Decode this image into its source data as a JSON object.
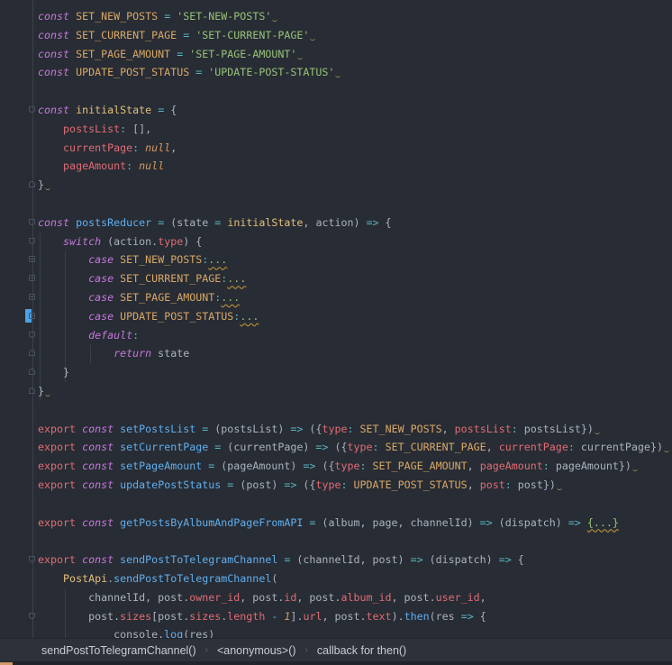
{
  "code": {
    "lines": [
      {
        "tokens": [
          [
            "k",
            "const"
          ],
          [
            "t",
            " "
          ],
          [
            "cn",
            "SET_NEW_POSTS"
          ],
          [
            "t",
            " "
          ],
          [
            "o",
            "="
          ],
          [
            "t",
            " "
          ],
          [
            "s",
            "'SET-NEW-POSTS'"
          ]
        ],
        "warn": true
      },
      {
        "tokens": [
          [
            "k",
            "const"
          ],
          [
            "t",
            " "
          ],
          [
            "cn",
            "SET_CURRENT_PAGE"
          ],
          [
            "t",
            " "
          ],
          [
            "o",
            "="
          ],
          [
            "t",
            " "
          ],
          [
            "s",
            "'SET-CURRENT-PAGE'"
          ]
        ],
        "warn": true
      },
      {
        "tokens": [
          [
            "k",
            "const"
          ],
          [
            "t",
            " "
          ],
          [
            "cn",
            "SET_PAGE_AMOUNT"
          ],
          [
            "t",
            " "
          ],
          [
            "o",
            "="
          ],
          [
            "t",
            " "
          ],
          [
            "s",
            "'SET-PAGE-AMOUNT'"
          ]
        ],
        "warn": true
      },
      {
        "tokens": [
          [
            "k",
            "const"
          ],
          [
            "t",
            " "
          ],
          [
            "cn",
            "UPDATE_POST_STATUS"
          ],
          [
            "t",
            " "
          ],
          [
            "o",
            "="
          ],
          [
            "t",
            " "
          ],
          [
            "s",
            "'UPDATE-POST-STATUS'"
          ]
        ],
        "warn": true
      },
      {
        "tokens": []
      },
      {
        "tokens": [
          [
            "k",
            "const"
          ],
          [
            "t",
            " "
          ],
          [
            "cl",
            "initialState"
          ],
          [
            "t",
            " "
          ],
          [
            "o",
            "="
          ],
          [
            "t",
            " {"
          ]
        ],
        "fold": "open"
      },
      {
        "tokens": [
          [
            "t",
            "    "
          ],
          [
            "p",
            "postsList"
          ],
          [
            "o",
            ":"
          ],
          [
            "t",
            " [],"
          ]
        ]
      },
      {
        "tokens": [
          [
            "t",
            "    "
          ],
          [
            "p",
            "currentPage"
          ],
          [
            "o",
            ":"
          ],
          [
            "t",
            " "
          ],
          [
            "n",
            "null"
          ],
          [
            "t",
            ","
          ]
        ]
      },
      {
        "tokens": [
          [
            "t",
            "    "
          ],
          [
            "p",
            "pageAmount"
          ],
          [
            "o",
            ":"
          ],
          [
            "t",
            " "
          ],
          [
            "n",
            "null"
          ]
        ]
      },
      {
        "tokens": [
          [
            "t",
            "}"
          ]
        ],
        "warn": true,
        "fold": "close"
      },
      {
        "tokens": []
      },
      {
        "tokens": [
          [
            "k",
            "const"
          ],
          [
            "t",
            " "
          ],
          [
            "f",
            "postsReducer"
          ],
          [
            "t",
            " "
          ],
          [
            "o",
            "="
          ],
          [
            "t",
            " (state "
          ],
          [
            "o",
            "="
          ],
          [
            "t",
            " "
          ],
          [
            "cl",
            "initialState"
          ],
          [
            "t",
            ", action) "
          ],
          [
            "o",
            "=>"
          ],
          [
            "t",
            " {"
          ]
        ],
        "fold": "open"
      },
      {
        "tokens": [
          [
            "t",
            "    "
          ],
          [
            "k",
            "switch"
          ],
          [
            "t",
            " (action."
          ],
          [
            "p",
            "type"
          ],
          [
            "t",
            ") {"
          ]
        ],
        "fold": "open"
      },
      {
        "tokens": [
          [
            "t",
            "        "
          ],
          [
            "k",
            "case"
          ],
          [
            "t",
            " "
          ],
          [
            "cn",
            "SET_NEW_POSTS"
          ],
          [
            "o",
            ":"
          ],
          [
            "fd",
            "..."
          ]
        ],
        "fold": "plus"
      },
      {
        "tokens": [
          [
            "t",
            "        "
          ],
          [
            "k",
            "case"
          ],
          [
            "t",
            " "
          ],
          [
            "cn",
            "SET_CURRENT_PAGE"
          ],
          [
            "o",
            ":"
          ],
          [
            "fd",
            "..."
          ]
        ],
        "fold": "plus"
      },
      {
        "tokens": [
          [
            "t",
            "        "
          ],
          [
            "k",
            "case"
          ],
          [
            "t",
            " "
          ],
          [
            "cn",
            "SET_PAGE_AMOUNT"
          ],
          [
            "o",
            ":"
          ],
          [
            "fd",
            "..."
          ]
        ],
        "fold": "plus"
      },
      {
        "tokens": [
          [
            "t",
            "        "
          ],
          [
            "k",
            "case"
          ],
          [
            "t",
            " "
          ],
          [
            "cn",
            "UPDATE_POST_STATUS"
          ],
          [
            "o",
            ":"
          ],
          [
            "fd",
            "..."
          ]
        ],
        "fold": "plus"
      },
      {
        "tokens": [
          [
            "t",
            "        "
          ],
          [
            "k",
            "default"
          ],
          [
            "o",
            ":"
          ]
        ],
        "fold": "open"
      },
      {
        "tokens": [
          [
            "t",
            "            "
          ],
          [
            "k",
            "return"
          ],
          [
            "t",
            " state"
          ]
        ],
        "fold": "close"
      },
      {
        "tokens": [
          [
            "t",
            "    }"
          ]
        ],
        "fold": "close"
      },
      {
        "tokens": [
          [
            "t",
            "}"
          ]
        ],
        "warn": true,
        "fold": "close"
      },
      {
        "tokens": []
      },
      {
        "tokens": [
          [
            "p",
            "export"
          ],
          [
            "t",
            " "
          ],
          [
            "k",
            "const"
          ],
          [
            "t",
            " "
          ],
          [
            "f",
            "setPostsList"
          ],
          [
            "t",
            " "
          ],
          [
            "o",
            "="
          ],
          [
            "t",
            " (postsList) "
          ],
          [
            "o",
            "=>"
          ],
          [
            "t",
            " ({"
          ],
          [
            "p",
            "type"
          ],
          [
            "o",
            ":"
          ],
          [
            "t",
            " "
          ],
          [
            "cn",
            "SET_NEW_POSTS"
          ],
          [
            "t",
            ", "
          ],
          [
            "p",
            "postsList"
          ],
          [
            "o",
            ":"
          ],
          [
            "t",
            " postsList})"
          ]
        ],
        "warn": true
      },
      {
        "tokens": [
          [
            "p",
            "export"
          ],
          [
            "t",
            " "
          ],
          [
            "k",
            "const"
          ],
          [
            "t",
            " "
          ],
          [
            "f",
            "setCurrentPage"
          ],
          [
            "t",
            " "
          ],
          [
            "o",
            "="
          ],
          [
            "t",
            " (currentPage) "
          ],
          [
            "o",
            "=>"
          ],
          [
            "t",
            " ({"
          ],
          [
            "p",
            "type"
          ],
          [
            "o",
            ":"
          ],
          [
            "t",
            " "
          ],
          [
            "cn",
            "SET_CURRENT_PAGE"
          ],
          [
            "t",
            ", "
          ],
          [
            "p",
            "currentPage"
          ],
          [
            "o",
            ":"
          ],
          [
            "t",
            " currentPage})"
          ]
        ],
        "warn": true
      },
      {
        "tokens": [
          [
            "p",
            "export"
          ],
          [
            "t",
            " "
          ],
          [
            "k",
            "const"
          ],
          [
            "t",
            " "
          ],
          [
            "f",
            "setPageAmount"
          ],
          [
            "t",
            " "
          ],
          [
            "o",
            "="
          ],
          [
            "t",
            " (pageAmount) "
          ],
          [
            "o",
            "=>"
          ],
          [
            "t",
            " ({"
          ],
          [
            "p",
            "type"
          ],
          [
            "o",
            ":"
          ],
          [
            "t",
            " "
          ],
          [
            "cn",
            "SET_PAGE_AMOUNT"
          ],
          [
            "t",
            ", "
          ],
          [
            "p",
            "pageAmount"
          ],
          [
            "o",
            ":"
          ],
          [
            "t",
            " pageAmount})"
          ]
        ],
        "warn": true
      },
      {
        "tokens": [
          [
            "p",
            "export"
          ],
          [
            "t",
            " "
          ],
          [
            "k",
            "const"
          ],
          [
            "t",
            " "
          ],
          [
            "f",
            "updatePostStatus"
          ],
          [
            "t",
            " "
          ],
          [
            "o",
            "="
          ],
          [
            "t",
            " (post) "
          ],
          [
            "o",
            "=>"
          ],
          [
            "t",
            " ({"
          ],
          [
            "p",
            "type"
          ],
          [
            "o",
            ":"
          ],
          [
            "t",
            " "
          ],
          [
            "cn",
            "UPDATE_POST_STATUS"
          ],
          [
            "t",
            ", "
          ],
          [
            "p",
            "post"
          ],
          [
            "o",
            ":"
          ],
          [
            "t",
            " post})"
          ]
        ],
        "warn": true
      },
      {
        "tokens": []
      },
      {
        "tokens": [
          [
            "p",
            "export"
          ],
          [
            "t",
            " "
          ],
          [
            "k",
            "const"
          ],
          [
            "t",
            " "
          ],
          [
            "f",
            "getPostsByAlbumAndPageFromAPI"
          ],
          [
            "t",
            " "
          ],
          [
            "o",
            "="
          ],
          [
            "t",
            " (album, page, channelId) "
          ],
          [
            "o",
            "=>"
          ],
          [
            "t",
            " (dispatch) "
          ],
          [
            "o",
            "=>"
          ],
          [
            "t",
            " "
          ],
          [
            "fd",
            "{...}"
          ]
        ]
      },
      {
        "tokens": []
      },
      {
        "tokens": [
          [
            "p",
            "export"
          ],
          [
            "t",
            " "
          ],
          [
            "k",
            "const"
          ],
          [
            "t",
            " "
          ],
          [
            "f",
            "sendPostToTelegramChannel"
          ],
          [
            "t",
            " "
          ],
          [
            "o",
            "="
          ],
          [
            "t",
            " (channelId, post) "
          ],
          [
            "o",
            "=>"
          ],
          [
            "t",
            " (dispatch) "
          ],
          [
            "o",
            "=>"
          ],
          [
            "t",
            " {"
          ]
        ],
        "fold": "open"
      },
      {
        "tokens": [
          [
            "t",
            "    "
          ],
          [
            "cl",
            "PostApi"
          ],
          [
            "t",
            "."
          ],
          [
            "f",
            "sendPostToTelegramChannel"
          ],
          [
            "t",
            "("
          ]
        ]
      },
      {
        "tokens": [
          [
            "t",
            "        channelId, post."
          ],
          [
            "p",
            "owner_id"
          ],
          [
            "t",
            ", post."
          ],
          [
            "p",
            "id"
          ],
          [
            "t",
            ", post."
          ],
          [
            "p",
            "album_id"
          ],
          [
            "t",
            ", post."
          ],
          [
            "p",
            "user_id"
          ],
          [
            "t",
            ","
          ]
        ]
      },
      {
        "tokens": [
          [
            "t",
            "        post."
          ],
          [
            "p",
            "sizes"
          ],
          [
            "t",
            "[post."
          ],
          [
            "p",
            "sizes"
          ],
          [
            "t",
            "."
          ],
          [
            "p",
            "length"
          ],
          [
            "t",
            " "
          ],
          [
            "o",
            "-"
          ],
          [
            "t",
            " "
          ],
          [
            "n",
            "1"
          ],
          [
            "t",
            "]."
          ],
          [
            "p",
            "url"
          ],
          [
            "t",
            ", post."
          ],
          [
            "p",
            "text"
          ],
          [
            "t",
            ")."
          ],
          [
            "f",
            "then"
          ],
          [
            "t",
            "(res "
          ],
          [
            "o",
            "=>"
          ],
          [
            "t",
            " {"
          ]
        ],
        "fold": "open"
      },
      {
        "tokens": [
          [
            "t",
            "            console."
          ],
          [
            "f",
            "log"
          ],
          [
            "t",
            "(res)"
          ]
        ]
      }
    ]
  },
  "breadcrumb": {
    "items": [
      "sendPostToTelegramChannel()",
      "<anonymous>()",
      "callback for then()"
    ],
    "separator": "›"
  }
}
